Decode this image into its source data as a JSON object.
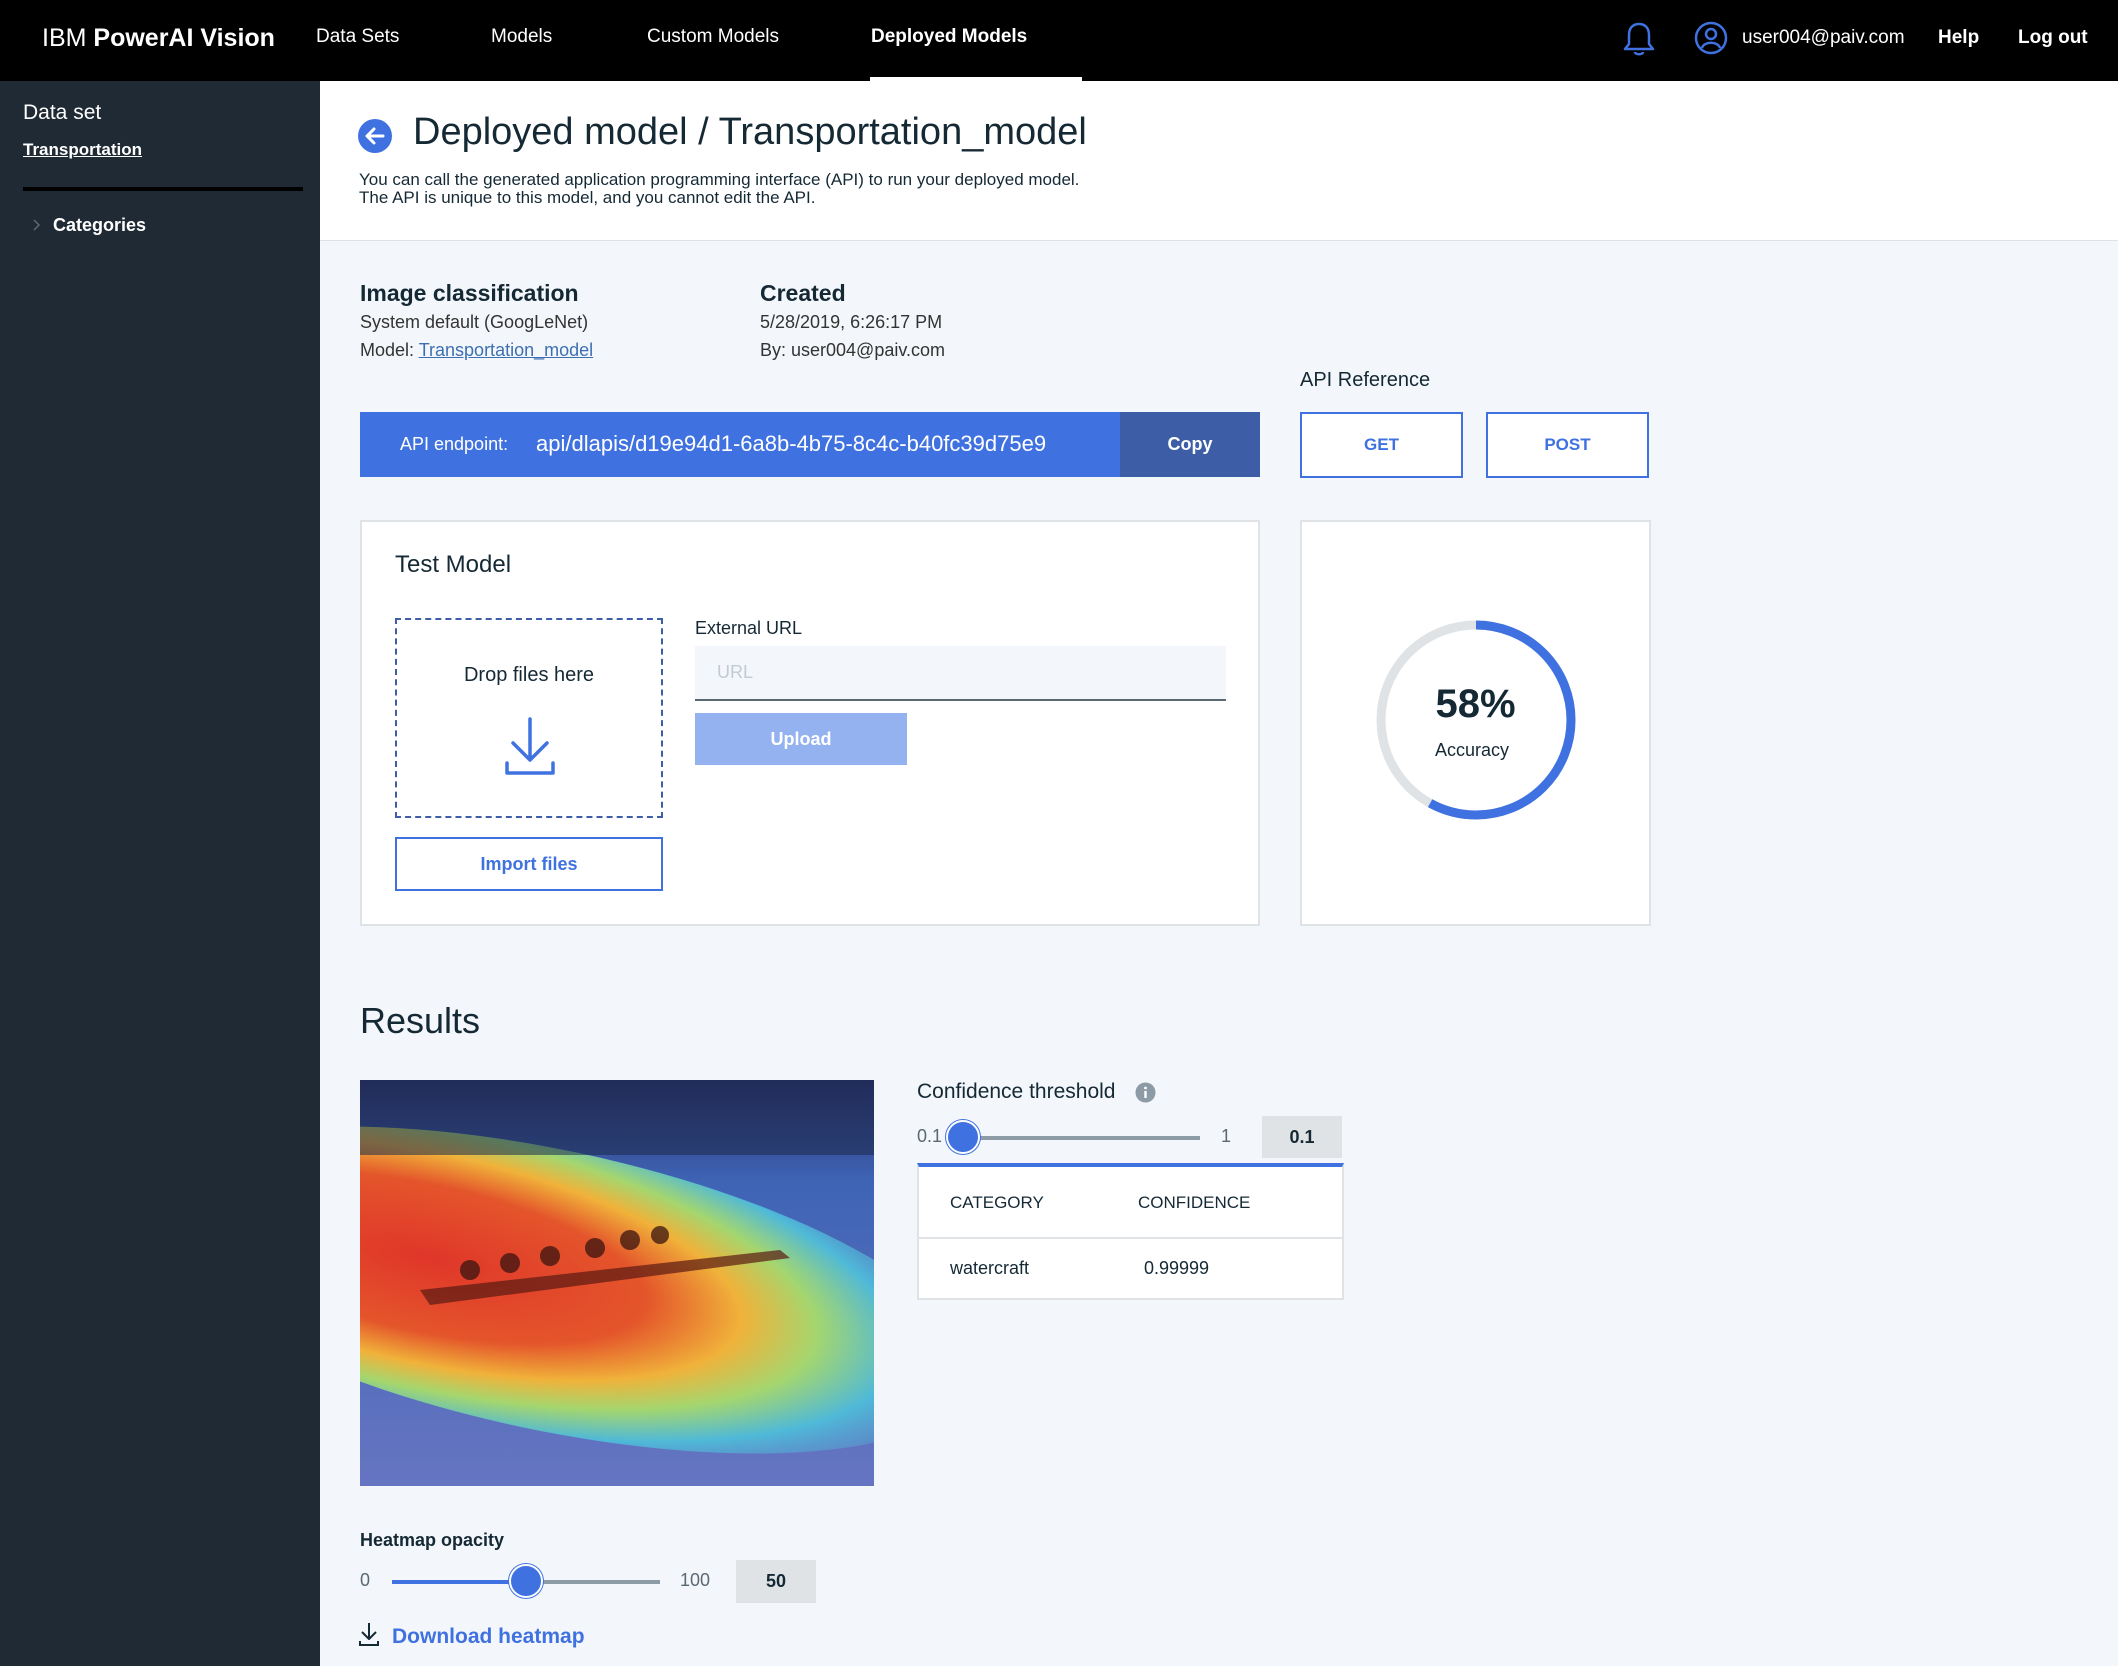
{
  "brand": {
    "prefix": "IBM",
    "name": "PowerAI Vision"
  },
  "nav": {
    "items": [
      {
        "label": "Data Sets"
      },
      {
        "label": "Models"
      },
      {
        "label": "Custom Models"
      },
      {
        "label": "Deployed Models",
        "active": true
      }
    ]
  },
  "top_right": {
    "user": "user004@paiv.com",
    "help": "Help",
    "logout": "Log out"
  },
  "sidebar": {
    "title": "Data set",
    "dataset": "Transportation",
    "categories": "Categories"
  },
  "header": {
    "title": "Deployed model / Transportation_model",
    "desc_line1": "You can call the generated application programming interface (API) to run your deployed model.",
    "desc_line2": "The API is unique to this model, and you cannot edit the API."
  },
  "info": {
    "type_heading": "Image classification",
    "type_detail": "System default (GoogLeNet)",
    "model_prefix": "Model: ",
    "model_link": "Transportation_model",
    "created_heading": "Created",
    "created_date": "5/28/2019, 6:26:17 PM",
    "created_by": "By: user004@paiv.com"
  },
  "api": {
    "label": "API endpoint:",
    "endpoint": "api/dlapis/d19e94d1-6a8b-4b75-8c4c-b40fc39d75e9",
    "copy": "Copy",
    "reference_label": "API Reference",
    "get": "GET",
    "post": "POST"
  },
  "test_model": {
    "title": "Test Model",
    "drop_text": "Drop files here",
    "import": "Import files",
    "external_url_label": "External URL",
    "url_placeholder": "URL",
    "upload": "Upload"
  },
  "accuracy": {
    "value_text": "58%",
    "label": "Accuracy",
    "fraction": 0.58
  },
  "results": {
    "title": "Results",
    "confidence_label": "Confidence threshold",
    "conf_min": "0.1",
    "conf_max": "1",
    "conf_value": "0.1",
    "table_headers": [
      "CATEGORY",
      "CONFIDENCE"
    ],
    "rows": [
      {
        "category": "watercraft",
        "confidence": "0.99999"
      }
    ],
    "heatmap_label": "Heatmap opacity",
    "heat_min": "0",
    "heat_max": "100",
    "heat_value": "50",
    "download": "Download heatmap"
  },
  "colors": {
    "accent": "#3f72e0",
    "topbar": "#000000",
    "sidebar": "#1f2a35",
    "copy_bg": "#3d5ea6"
  }
}
